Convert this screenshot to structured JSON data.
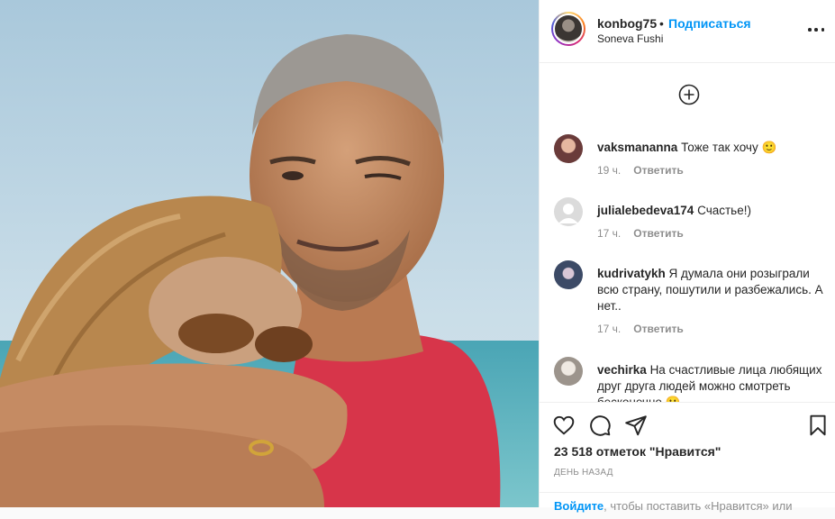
{
  "post": {
    "username": "konbog75",
    "separator": "•",
    "follow_label": "Подписаться",
    "location": "Soneva Fushi",
    "more_icon": "more-options-icon"
  },
  "comments": [
    {
      "user": "vaksmananna",
      "text": "Тоже так хочу 🙂",
      "time": "19 ч.",
      "reply": "Ответить",
      "avatar_color": "#6a3b3a"
    },
    {
      "user": "julialebedeva174",
      "text": "Счастье!)",
      "time": "17 ч.",
      "reply": "Ответить",
      "avatar_color": "#dbdbdb"
    },
    {
      "user": "kudrivatykh",
      "text": "Я думала они розыграли всю страну, пошутили и разбежались. А нет..",
      "time": "17 ч.",
      "reply": "Ответить",
      "avatar_color": "#3c4a66"
    },
    {
      "user": "vechirka",
      "text": "На счастливые лица любящих друг друга людей можно смотреть бесконечно 🙂",
      "time": "",
      "reply": "",
      "avatar_color": "#c9c3bd"
    }
  ],
  "stats": {
    "likes": "23 518 отметок \"Нравится\"",
    "date": "ДЕНЬ НАЗАД"
  },
  "login_prompt": {
    "link": "Войдите",
    "text": ", чтобы поставить «Нравится» или"
  },
  "icons": [
    "plus-circle-icon",
    "heart-icon",
    "comment-icon",
    "share-icon",
    "bookmark-icon"
  ],
  "colors": {
    "accent": "#0095f6",
    "text": "#262626",
    "muted": "#8e8e8e"
  }
}
